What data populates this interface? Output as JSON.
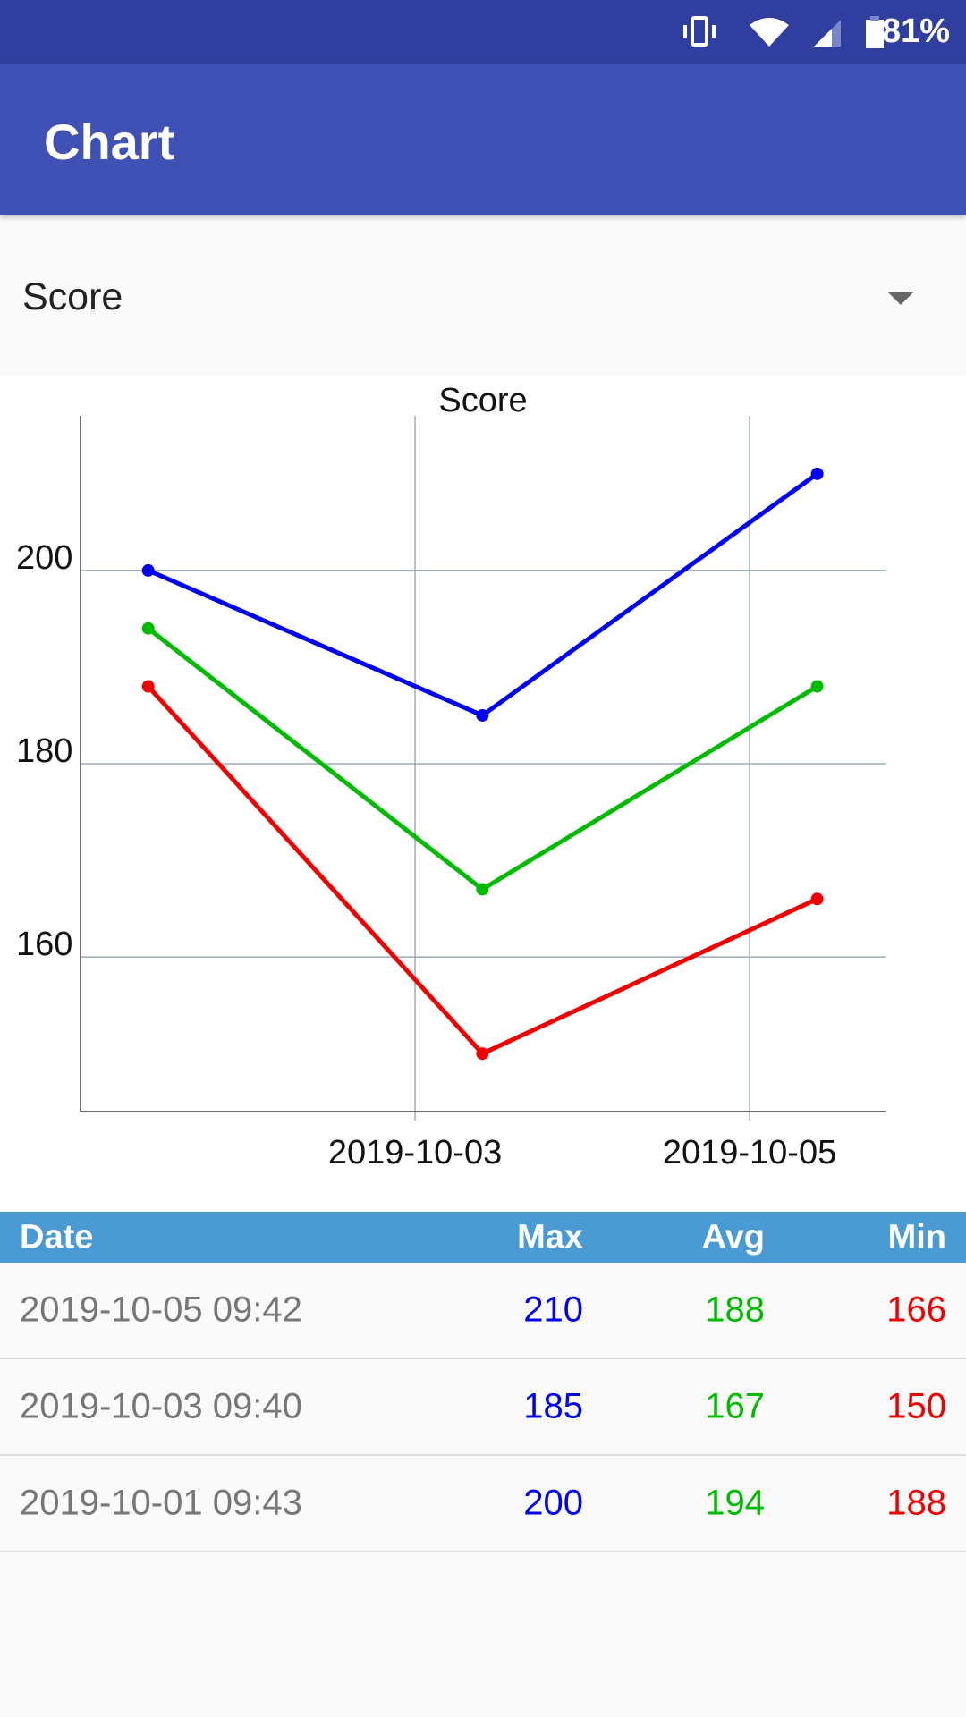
{
  "status_bar": {
    "battery": "81%",
    "icons": [
      "vibrate-icon",
      "wifi-icon",
      "signal-no-sim-icon",
      "battery-charging-icon"
    ]
  },
  "app_bar": {
    "title": "Chart"
  },
  "spinner": {
    "selected": "Score"
  },
  "colors": {
    "max": "#0000ee",
    "avg": "#00bb00",
    "min": "#ee0000",
    "header": "#4a9ad4"
  },
  "chart_data": {
    "type": "line",
    "title": "Score",
    "x": [
      "2019-10-01 09:43",
      "2019-10-03 09:40",
      "2019-10-05 09:42"
    ],
    "xticks": [
      "2019-10-03",
      "2019-10-05"
    ],
    "yticks": [
      160,
      180,
      200
    ],
    "ylim": [
      144,
      216
    ],
    "xlim": [
      "2019-10-01 00:00",
      "2019-10-05 19:30"
    ],
    "grid": true,
    "series": [
      {
        "key": "max",
        "values": [
          200,
          185,
          210
        ]
      },
      {
        "key": "avg",
        "values": [
          194,
          167,
          188
        ]
      },
      {
        "key": "min",
        "values": [
          188,
          150,
          166
        ]
      }
    ]
  },
  "table": {
    "headers": [
      "Date",
      "Max",
      "Avg",
      "Min"
    ],
    "rows": [
      [
        "2019-10-05 09:42",
        "210",
        "188",
        "166"
      ],
      [
        "2019-10-03 09:40",
        "185",
        "167",
        "150"
      ],
      [
        "2019-10-01 09:43",
        "200",
        "194",
        "188"
      ]
    ]
  }
}
